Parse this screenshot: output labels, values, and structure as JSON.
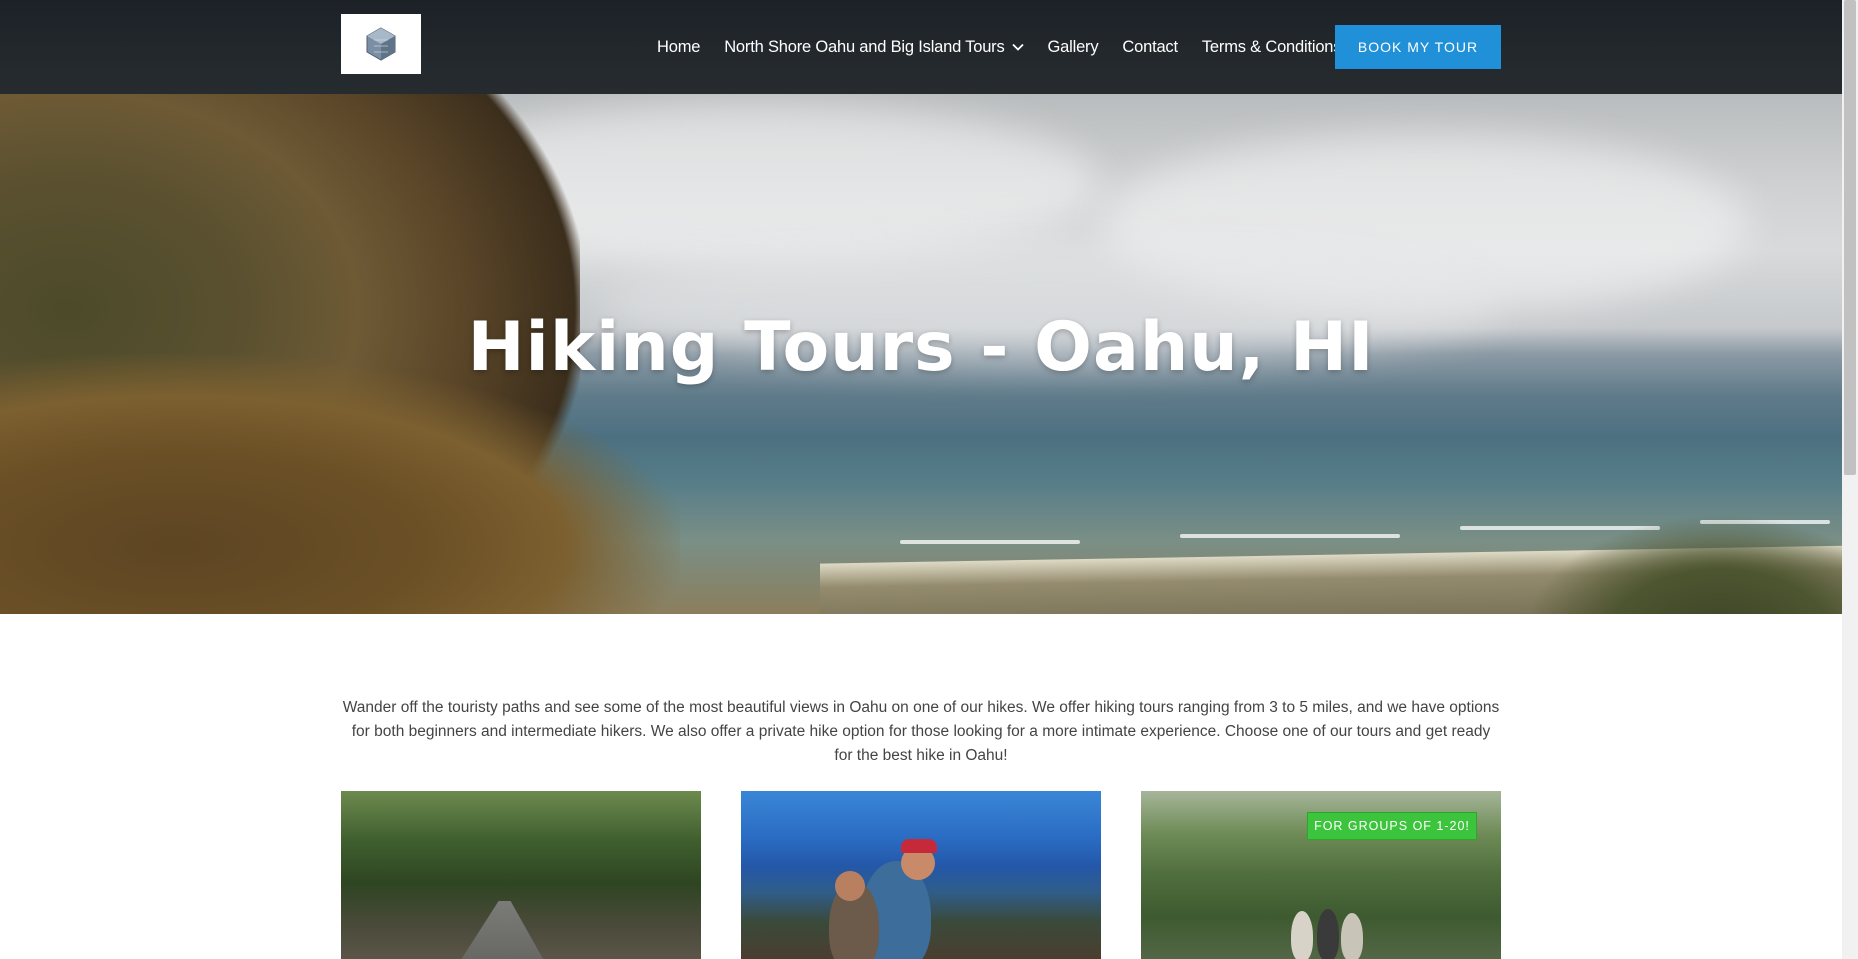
{
  "header": {
    "logo_alt": "North Shore Hiking Tours logo",
    "nav": [
      {
        "label": "Home"
      },
      {
        "label": "North Shore Oahu and Big Island Tours",
        "has_dropdown": true
      },
      {
        "label": "Gallery"
      },
      {
        "label": "Contact"
      },
      {
        "label": "Terms & Conditions"
      }
    ],
    "cta_label": "BOOK MY TOUR",
    "cta_color": "#2090d8"
  },
  "hero": {
    "title": "Hiking Tours - Oahu, HI"
  },
  "intro": {
    "text": "Wander off the touristy paths and see some of the most beautiful views in Oahu on one of our hikes. We offer hiking tours ranging from 3 to 5 miles, and we have options for both beginners and intermediate hikers. We also offer a private hike option for those looking for a more intimate experience. Choose one of our tours and get ready for the best hike in Oahu!"
  },
  "tour_cards": [
    {
      "image": "dirt-road-forest-photo"
    },
    {
      "image": "hikers-ocean-view-photo"
    },
    {
      "image": "group-jungle-photo",
      "badge": "FOR GROUPS OF 1-20!",
      "badge_color": "#3cc43c"
    }
  ]
}
